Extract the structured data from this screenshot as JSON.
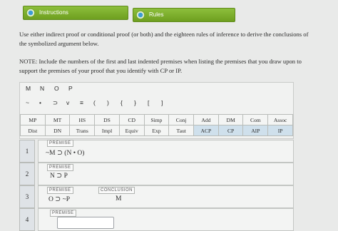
{
  "tabs": [
    {
      "label": "Instructions"
    },
    {
      "label": "Rules"
    }
  ],
  "instructions": {
    "line1": "Use either indirect proof or conditional proof (or both) and the eighteen rules of inference to derive the conclusions of",
    "line2": "the symbolized argument below.",
    "line3": "NOTE: Include the numbers of the first and last indented premises when listing the premises that you draw upon to",
    "line4": "support the premises of your proof that you identify with CP or IP."
  },
  "variables": [
    "M",
    "N",
    "O",
    "P"
  ],
  "symbols": [
    "~",
    "•",
    "⊃",
    "v",
    "≡",
    "(",
    ")",
    "{",
    "}",
    "[",
    "]"
  ],
  "rules_row1": [
    "MP",
    "MT",
    "HS",
    "DS",
    "CD",
    "Simp",
    "Conj",
    "Add",
    "DM",
    "Com",
    "Assoc"
  ],
  "rules_row2": [
    "Dist",
    "DN",
    "Trans",
    "Impl",
    "Equiv",
    "Exp",
    "Taut",
    "ACP",
    "CP",
    "AIP",
    "IP"
  ],
  "lines": [
    {
      "num": "1",
      "tag": "PREMISE",
      "expr": "~M ⊃ (N • O)"
    },
    {
      "num": "2",
      "tag": "PREMISE",
      "expr": "N ⊃ P"
    },
    {
      "num": "3",
      "tag": "PREMISE",
      "expr": "O ⊃ ~P",
      "conclusion_tag": "CONCLUSION",
      "conclusion": "M"
    },
    {
      "num": "4",
      "tag": "PREMISE",
      "expr": ""
    }
  ]
}
